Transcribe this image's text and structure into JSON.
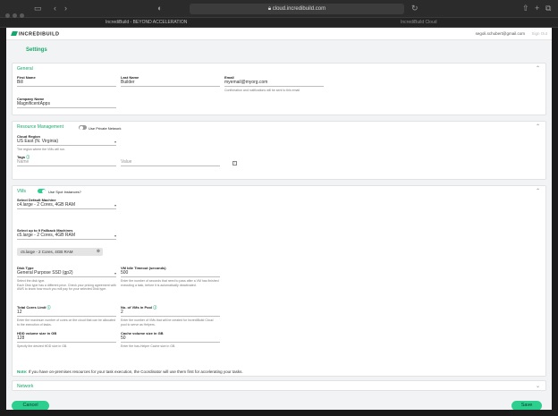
{
  "browser": {
    "url": "cloud.incredibuild.com",
    "tabs": [
      "IncrediBuild - BEYOND ACCELERATION",
      "IncrediBuild Cloud"
    ]
  },
  "header": {
    "logo_text": "INCREDIBUILD",
    "user_email": "segoli.schubert@gmail.com",
    "signout_label": "Sign Out"
  },
  "page_title": "Settings",
  "general": {
    "title": "General",
    "first_name_label": "First Name",
    "first_name_value": "Bill",
    "last_name_label": "Last Name",
    "last_name_value": "Builder",
    "email_label": "Email",
    "email_value": "myemail@myorg.com",
    "email_hint": "Confirmation and notifications will be sent to this email",
    "company_label": "Company Name",
    "company_value": "MagnificentApps"
  },
  "resource_management": {
    "title": "Resource Management",
    "private_network_label": "Use Private Network",
    "private_network_on": false,
    "region_label": "Cloud Region",
    "region_value": "US East (N. Virginia)",
    "region_hint": "The region where the VMs will run.",
    "tags_label": "Tags",
    "tag_name_placeholder": "Name",
    "tag_value_placeholder": "Value"
  },
  "vms": {
    "title": "VMs",
    "spot_label": "Use Spot Instances?",
    "spot_on": true,
    "default_machine_label": "Select Default Machine",
    "default_machine_value": "c4.large - 2 Cores, 4GB RAM",
    "fallback_label": "Select up to 9 Fallback Machines",
    "fallback_value": "c5.large - 2 Cores, 4GB RAM",
    "fallback_chip": "c5.large - 2 Cores, 4GB RAM",
    "disk_type_label": "Disk Type",
    "disk_type_value": "General Purpose SSD (gp2)",
    "disk_type_hint": "Select the disk type.\nEach Disk type has a different price. Check your pricing agreement with AWS to know how much you will pay for your selected Disk type.",
    "idle_timeout_label": "VM Idle Timeout (seconds)",
    "idle_timeout_value": "500",
    "idle_timeout_hint": "Enter the number of seconds that need to pass after a VM has finished executing a task, before it is automatically deactivated.",
    "total_cores_label": "Total Cores Limit",
    "total_cores_value": "12",
    "total_cores_hint": "Enter the maximum number of cores on the cloud that can be allocated to the execution of tasks.",
    "pool_label": "No. of VMs in Pool",
    "pool_value": "2",
    "pool_hint": "Enter the number of VMs that will be created for IncrediBuild Cloud pool to serve as Helpers.",
    "hdd_label": "HDD volume size in GB",
    "hdd_value": "128",
    "hdd_hint": "Specify the desired HDD size in GB.",
    "cache_label": "Cache volume size in GB",
    "cache_value": "50",
    "cache_hint": "Enter the has-Helper Cache size in GB.",
    "note_prefix": "Note:",
    "note_text": " If you have on-premises resources for your task execution, the Coordinator will use them first for accelerating your tasks."
  },
  "network": {
    "title": "Network"
  },
  "actions": {
    "cancel_label": "Cancel",
    "save_label": "Save"
  },
  "colors": {
    "accent": "#16a86b",
    "button": "#2dcf8f",
    "toggle_on": "#2dcf8f",
    "toggle_off": "#9a9a9a"
  }
}
